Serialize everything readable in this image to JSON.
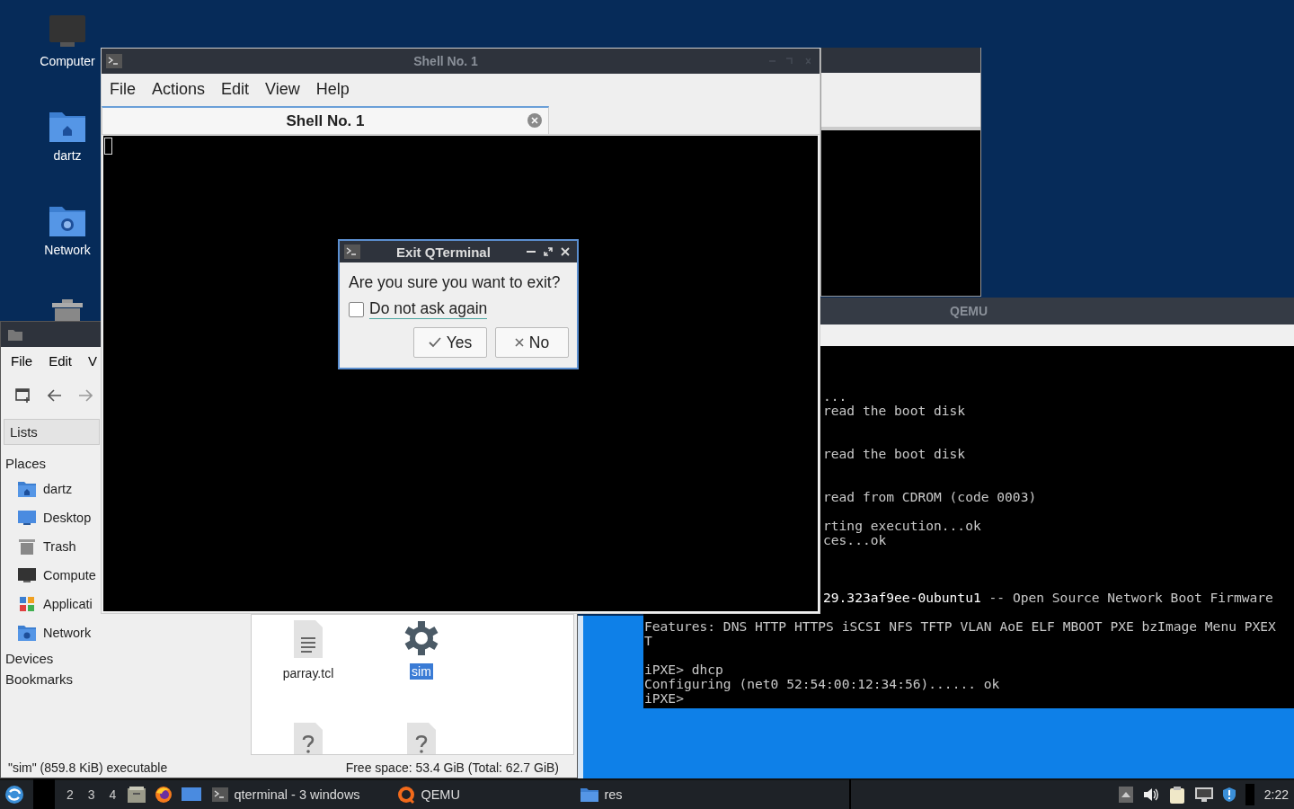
{
  "desktop_icons": [
    {
      "label": "Computer",
      "kind": "computer"
    },
    {
      "label": "dartz",
      "kind": "home"
    },
    {
      "label": "Network",
      "kind": "network"
    },
    {
      "kind": "trash"
    }
  ],
  "qemu": {
    "title": "QEMU",
    "lines": [
      {
        "text": "...",
        "kind": "cut"
      },
      {
        "text": "read the boot disk",
        "kind": "cut"
      },
      {
        "text": "read the boot disk",
        "kind": "cut"
      },
      {
        "text": "read from CDROM (code 0003)",
        "kind": "cut"
      },
      {
        "text": "rting execution...ok",
        "kind": "cut"
      },
      {
        "text": "ces...ok",
        "kind": "cut"
      },
      {
        "text": "**29.323af9ee-0ubuntu1** -- Open Source Network Boot Firmware",
        "kind": "cut"
      },
      {
        "text": "Features: DNS HTTP HTTPS iSCSI NFS TFTP VLAN AoE ELF MBOOT PXE bzImage Menu PXEX",
        "kind": "full"
      },
      {
        "text": "T",
        "kind": "full"
      },
      {
        "text": "iPXE> dhcp",
        "kind": "full"
      },
      {
        "text": "Configuring (net0 52:54:00:12:34:56)...... ok",
        "kind": "full"
      },
      {
        "text": "iPXE>",
        "kind": "full"
      }
    ]
  },
  "file_manager": {
    "menu": [
      "File",
      "Edit",
      "V"
    ],
    "side_tab": "Lists",
    "places_heading": "Places",
    "places": [
      {
        "label": "dartz",
        "kind": "home"
      },
      {
        "label": "Desktop",
        "kind": "desktop"
      },
      {
        "label": "Trash",
        "kind": "trash"
      },
      {
        "label": "Compute",
        "kind": "computer"
      },
      {
        "label": "Applicati",
        "kind": "apps"
      },
      {
        "label": "Network",
        "kind": "network"
      }
    ],
    "sections": [
      "Devices",
      "Bookmarks"
    ],
    "files": [
      {
        "name": "parray.tcl",
        "kind": "text",
        "selected": false
      },
      {
        "name": "sim",
        "kind": "exec",
        "selected": true
      },
      {
        "kind": "unknown"
      },
      {
        "kind": "unknown"
      }
    ],
    "status_left": "\"sim\" (859.8 KiB) executable",
    "status_right": "Free space: 53.4 GiB (Total: 62.7 GiB)"
  },
  "terminal": {
    "title": "Shell No. 1",
    "menu": [
      "File",
      "Actions",
      "Edit",
      "View",
      "Help"
    ],
    "tab": {
      "label": "Shell No. 1",
      "selected": true
    }
  },
  "dialog": {
    "title": "Exit QTerminal",
    "message": "Are you sure you want to exit?",
    "checkbox": {
      "label": "Do not ask again",
      "checked": false
    },
    "buttons": [
      {
        "label": "Yes",
        "kind": "yes"
      },
      {
        "label": "No",
        "kind": "no"
      }
    ]
  },
  "taskbar": {
    "workspaces": [
      "2",
      "3",
      "4"
    ],
    "tasks": [
      {
        "label": "qterminal - 3 windows",
        "kind": "terminal"
      },
      {
        "label": "QEMU",
        "kind": "qemu"
      },
      {
        "label": "res",
        "kind": "folder"
      }
    ],
    "clock": "2:22"
  }
}
